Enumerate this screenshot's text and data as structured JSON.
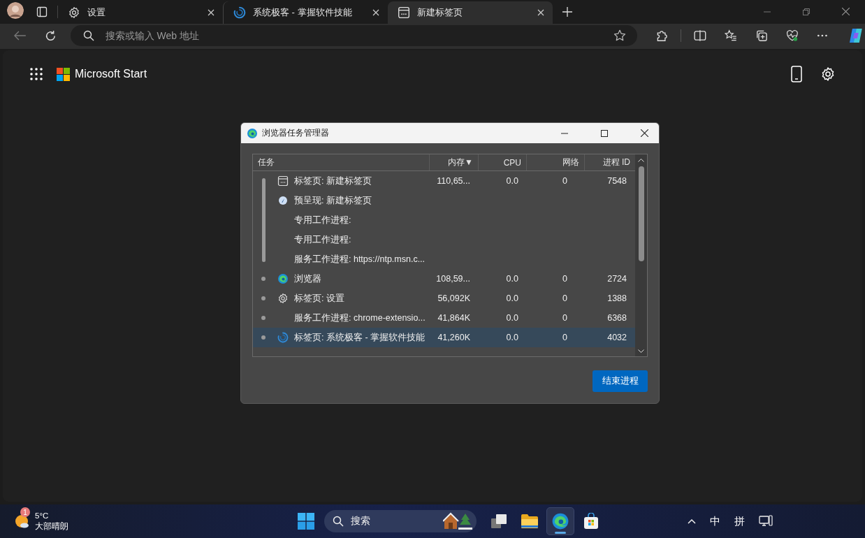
{
  "browser": {
    "tabs": [
      {
        "title": "设置",
        "kind": "gear",
        "selected": false
      },
      {
        "title": "系统极客 - 掌握软件技能",
        "kind": "loading",
        "selected": false
      },
      {
        "title": "新建标签页",
        "kind": "newtab",
        "selected": true
      }
    ],
    "address": {
      "placeholder": "搜索或输入 Web 地址"
    }
  },
  "page": {
    "brand": "Microsoft Start"
  },
  "task_manager": {
    "title": "浏览器任务管理器",
    "columns": [
      {
        "label": "任务"
      },
      {
        "label": "内存",
        "sort": "▼"
      },
      {
        "label": "CPU"
      },
      {
        "label": "网络"
      },
      {
        "label": "进程 ID"
      }
    ],
    "groups": [
      {
        "rows": [
          {
            "kind": "newtab",
            "task": "标签页: 新建标签页",
            "memory": "110,65...",
            "cpu": "0.0",
            "network": "0",
            "pid": "7548",
            "selected": false
          },
          {
            "kind": "prerender",
            "task": "预呈现: 新建标签页",
            "memory": "",
            "cpu": "",
            "network": "",
            "pid": "",
            "selected": false
          },
          {
            "kind": "none",
            "task": "专用工作进程:",
            "memory": "",
            "cpu": "",
            "network": "",
            "pid": "",
            "selected": false
          },
          {
            "kind": "none",
            "task": "专用工作进程:",
            "memory": "",
            "cpu": "",
            "network": "",
            "pid": "",
            "selected": false
          },
          {
            "kind": "none",
            "task": "服务工作进程: https://ntp.msn.c...",
            "memory": "",
            "cpu": "",
            "network": "",
            "pid": "",
            "selected": false
          }
        ]
      },
      {
        "rows": [
          {
            "kind": "edge",
            "task": "浏览器",
            "memory": "108,59...",
            "cpu": "0.0",
            "network": "0",
            "pid": "2724",
            "selected": false
          }
        ]
      },
      {
        "rows": [
          {
            "kind": "gear",
            "task": "标签页: 设置",
            "memory": "56,092K",
            "cpu": "0.0",
            "network": "0",
            "pid": "1388",
            "selected": false
          }
        ]
      },
      {
        "rows": [
          {
            "kind": "none",
            "task": "服务工作进程: chrome-extensio...",
            "memory": "41,864K",
            "cpu": "0.0",
            "network": "0",
            "pid": "6368",
            "selected": false
          }
        ]
      },
      {
        "rows": [
          {
            "kind": "loading",
            "task": "标签页: 系统极客 - 掌握软件技能",
            "memory": "41,260K",
            "cpu": "0.0",
            "network": "0",
            "pid": "4032",
            "selected": true
          }
        ]
      }
    ],
    "end_button": "结束进程"
  },
  "taskbar": {
    "weather": {
      "badge": "1",
      "temperature": "5°C",
      "condition": "大部晴朗"
    },
    "search": {
      "placeholder": "搜索"
    },
    "apps": [
      {
        "kind": "taskview",
        "active": false
      },
      {
        "kind": "explorer",
        "active": false
      },
      {
        "kind": "edge",
        "active": true
      },
      {
        "kind": "store",
        "active": false
      }
    ],
    "tray": [
      "中",
      "拼"
    ]
  }
}
